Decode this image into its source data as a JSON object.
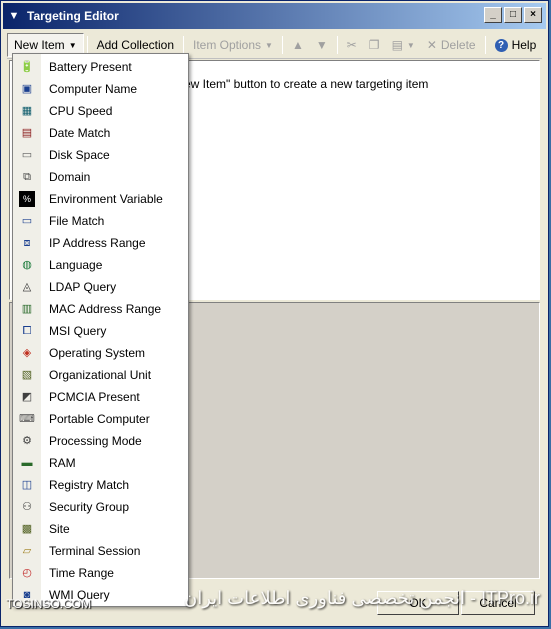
{
  "window": {
    "title": "Targeting Editor"
  },
  "toolbar": {
    "new_item": "New Item",
    "add_collection": "Add Collection",
    "item_options": "Item Options",
    "delete": "Delete",
    "help": "Help"
  },
  "content": {
    "hint": "ew Item\" button to create a new targeting item"
  },
  "buttons": {
    "ok": "OK",
    "cancel": "Cancel"
  },
  "menu": {
    "items": [
      {
        "label": "Battery Present",
        "icon": "battery-icon"
      },
      {
        "label": "Computer Name",
        "icon": "computer-icon"
      },
      {
        "label": "CPU Speed",
        "icon": "cpu-icon"
      },
      {
        "label": "Date Match",
        "icon": "calendar-icon"
      },
      {
        "label": "Disk Space",
        "icon": "disk-icon"
      },
      {
        "label": "Domain",
        "icon": "domain-icon"
      },
      {
        "label": "Environment Variable",
        "icon": "env-variable-icon"
      },
      {
        "label": "File Match",
        "icon": "file-icon"
      },
      {
        "label": "IP Address Range",
        "icon": "network-icon"
      },
      {
        "label": "Language",
        "icon": "globe-icon"
      },
      {
        "label": "LDAP Query",
        "icon": "ldap-icon"
      },
      {
        "label": "MAC Address Range",
        "icon": "mac-icon"
      },
      {
        "label": "MSI Query",
        "icon": "msi-icon"
      },
      {
        "label": "Operating System",
        "icon": "os-icon"
      },
      {
        "label": "Organizational Unit",
        "icon": "ou-icon"
      },
      {
        "label": "PCMCIA Present",
        "icon": "pcmcia-icon"
      },
      {
        "label": "Portable Computer",
        "icon": "laptop-icon"
      },
      {
        "label": "Processing Mode",
        "icon": "processing-icon"
      },
      {
        "label": "RAM",
        "icon": "ram-icon"
      },
      {
        "label": "Registry Match",
        "icon": "registry-icon"
      },
      {
        "label": "Security Group",
        "icon": "group-icon"
      },
      {
        "label": "Site",
        "icon": "site-icon"
      },
      {
        "label": "Terminal Session",
        "icon": "terminal-icon"
      },
      {
        "label": "Time Range",
        "icon": "clock-icon"
      },
      {
        "label": "WMI Query",
        "icon": "wmi-icon"
      }
    ]
  },
  "watermark": {
    "left": "TOSINSO.COM",
    "right": "ITPro.ir - انجمن تخصصی فناوری اطلاعات ایران"
  }
}
